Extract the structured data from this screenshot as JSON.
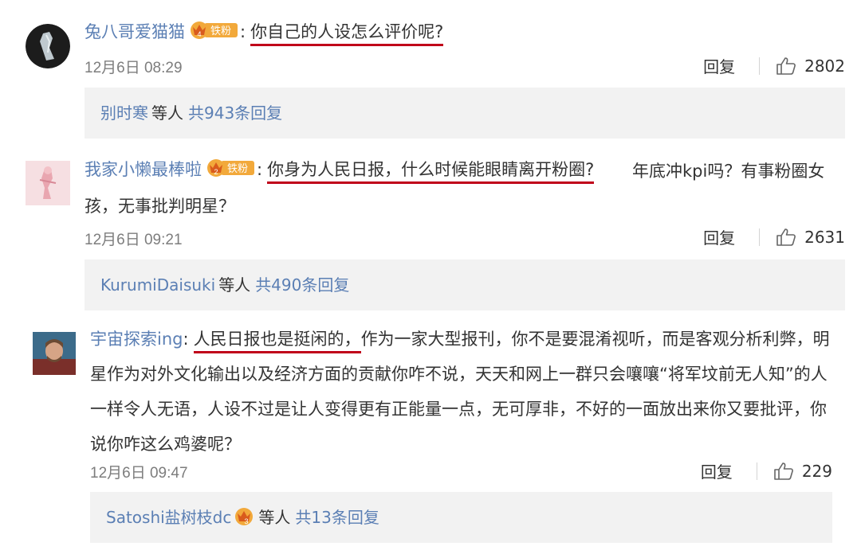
{
  "comments": [
    {
      "username": "兔八哥爱猫猫",
      "badge_label": "铁粉",
      "badge_level": "4",
      "colon": ":",
      "text_highlight": "你自己的人设怎么评价呢?",
      "text_rest": "",
      "time": "12月6日 08:29",
      "reply_label": "回复",
      "likes": "2802",
      "replies": {
        "user": "别时寒",
        "etc": "等人",
        "count": "共943条回复",
        "badge_level": ""
      }
    },
    {
      "username": "我家小懒最棒啦",
      "badge_label": "铁粉",
      "badge_level": "2",
      "colon": ":",
      "text_highlight": "你身为人民日报，什么时候能眼睛离开粉圈?",
      "text_rest": "年底冲kpi吗？有事粉圈女孩，无事批判明星？",
      "time": "12月6日 09:21",
      "reply_label": "回复",
      "likes": "2631",
      "replies": {
        "user": "KurumiDaisuki",
        "etc": "等人",
        "count": "共490条回复",
        "badge_level": ""
      }
    },
    {
      "username": "宇宙探索ing",
      "badge_label": "",
      "badge_level": "",
      "colon": ":",
      "text_highlight": "人民日报也是挺闲的，",
      "text_rest": "作为一家大型报刊，你不是要混淆视听，而是客观分析利弊，明星作为对外文化输出以及经济方面的贡献你咋不说，天天和网上一群只会嚷嚷“将军坟前无人知”的人一样令人无语，人设不过是让人变得更有正能量一点，无可厚非，不好的一面放出来你又要批评，你说你咋这么鸡婆呢？",
      "time": "12月6日 09:47",
      "reply_label": "回复",
      "likes": "229",
      "replies": {
        "user": "Satoshi盐树枝dc",
        "etc": "等人",
        "count": "共13条回复",
        "badge_level": "3"
      }
    }
  ],
  "colors": {
    "username": "#5b7fb4",
    "underline": "#c0001a",
    "reply_box": "#f2f2f2",
    "badge": "#f2a93b"
  },
  "icons": [
    "thumbs-up-icon",
    "crown-badge-icon"
  ]
}
